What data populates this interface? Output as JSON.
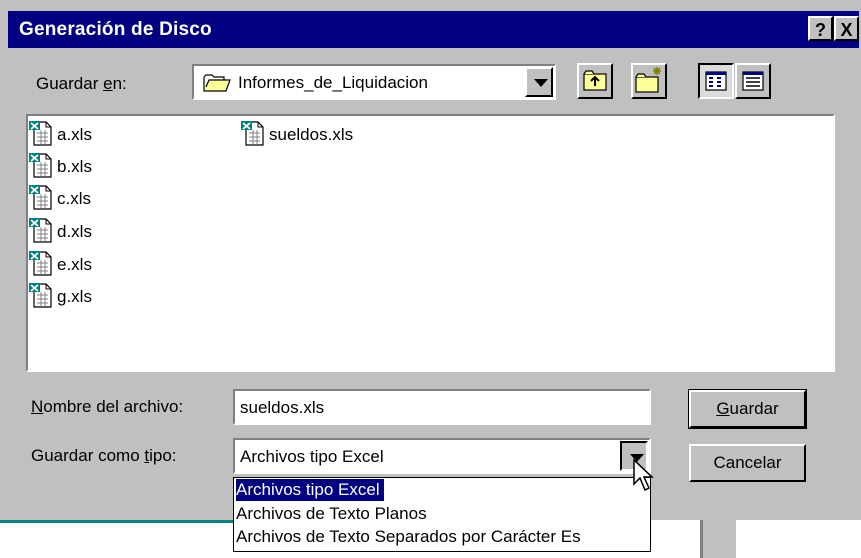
{
  "window": {
    "title": "Generación de Disco",
    "help_button": "?",
    "close_button": "X"
  },
  "save_in": {
    "label_pre": "Guardar ",
    "label_key": "e",
    "label_post": "n:",
    "value": "Informes_de_Liquidacion"
  },
  "toolbar": {
    "icons": [
      "up-one-level-icon",
      "new-folder-icon",
      "list-view-icon",
      "details-view-icon"
    ]
  },
  "files": {
    "items": [
      "a.xls",
      "b.xls",
      "c.xls",
      "d.xls",
      "e.xls",
      "g.xls",
      "sueldos.xls"
    ]
  },
  "filename": {
    "label_key": "N",
    "label_post": "ombre del archivo:",
    "value": "sueldos.xls"
  },
  "filetype": {
    "label_pre": "Guardar como ",
    "label_key": "t",
    "label_post": "ipo:",
    "value": "Archivos tipo Excel",
    "options": [
      "Archivos tipo Excel",
      "Archivos de Texto Planos",
      "Archivos de Texto Separados por Carácter Es"
    ]
  },
  "buttons": {
    "save_key": "G",
    "save_rest": "uardar",
    "cancel": "Cancelar"
  },
  "colors": {
    "titlebar": "#000080",
    "face": "#c0c0c0",
    "selection": "#000080"
  }
}
